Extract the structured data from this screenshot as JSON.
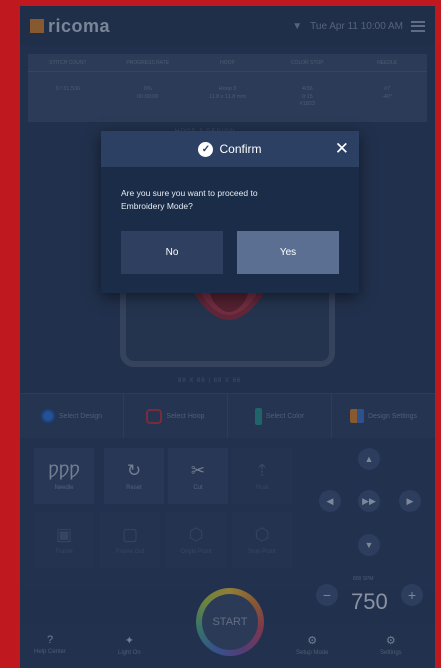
{
  "app": {
    "brand": "ricoma",
    "datetime": "Tue Apr 11 10:00 AM"
  },
  "info_table": {
    "headers": [
      "STITCH COUNT",
      "PROGRESS RATE",
      "HOOP",
      "COLOR STOP",
      "NEEDLE"
    ],
    "values": [
      "0 / 31,536",
      "0%\n00:00:00",
      "Hoop 3\n11.8 x 11.8 mm",
      "4/36\n0:15\n#1823",
      "#7\n-40°"
    ]
  },
  "hoop_labels": {
    "top": "HOOP 3 DESIGN",
    "bottom": "88 X 86 | 88 X 86"
  },
  "tabs": [
    {
      "label": "Select Design"
    },
    {
      "label": "Select Hoop"
    },
    {
      "label": "Select Color"
    },
    {
      "label": "Design Settings"
    }
  ],
  "tools": [
    {
      "label": "Needle",
      "glyph": "ǷǷǷ"
    },
    {
      "label": "Reset",
      "glyph": "↻"
    },
    {
      "label": "Cut",
      "glyph": "✂"
    },
    {
      "label": "Float",
      "glyph": "⇡"
    },
    {
      "label": "Frame",
      "glyph": "▣"
    },
    {
      "label": "Frame Out",
      "glyph": "▢"
    },
    {
      "label": "Origin Point",
      "glyph": "⬡"
    },
    {
      "label": "Stop Point",
      "glyph": "⬡"
    }
  ],
  "speed": {
    "label": "800 SPM",
    "value": "750"
  },
  "start_label": "START",
  "bottom_bar": [
    {
      "label": "Help Center",
      "glyph": "?"
    },
    {
      "label": "Light On",
      "glyph": "✦"
    },
    {
      "label": "Setup Mode",
      "glyph": "⚙"
    },
    {
      "label": "Settings",
      "glyph": "⚙"
    }
  ],
  "dialog": {
    "title": "Confirm",
    "message": "Are you sure you want to proceed to Embroidery Mode?",
    "no_label": "No",
    "yes_label": "Yes"
  }
}
